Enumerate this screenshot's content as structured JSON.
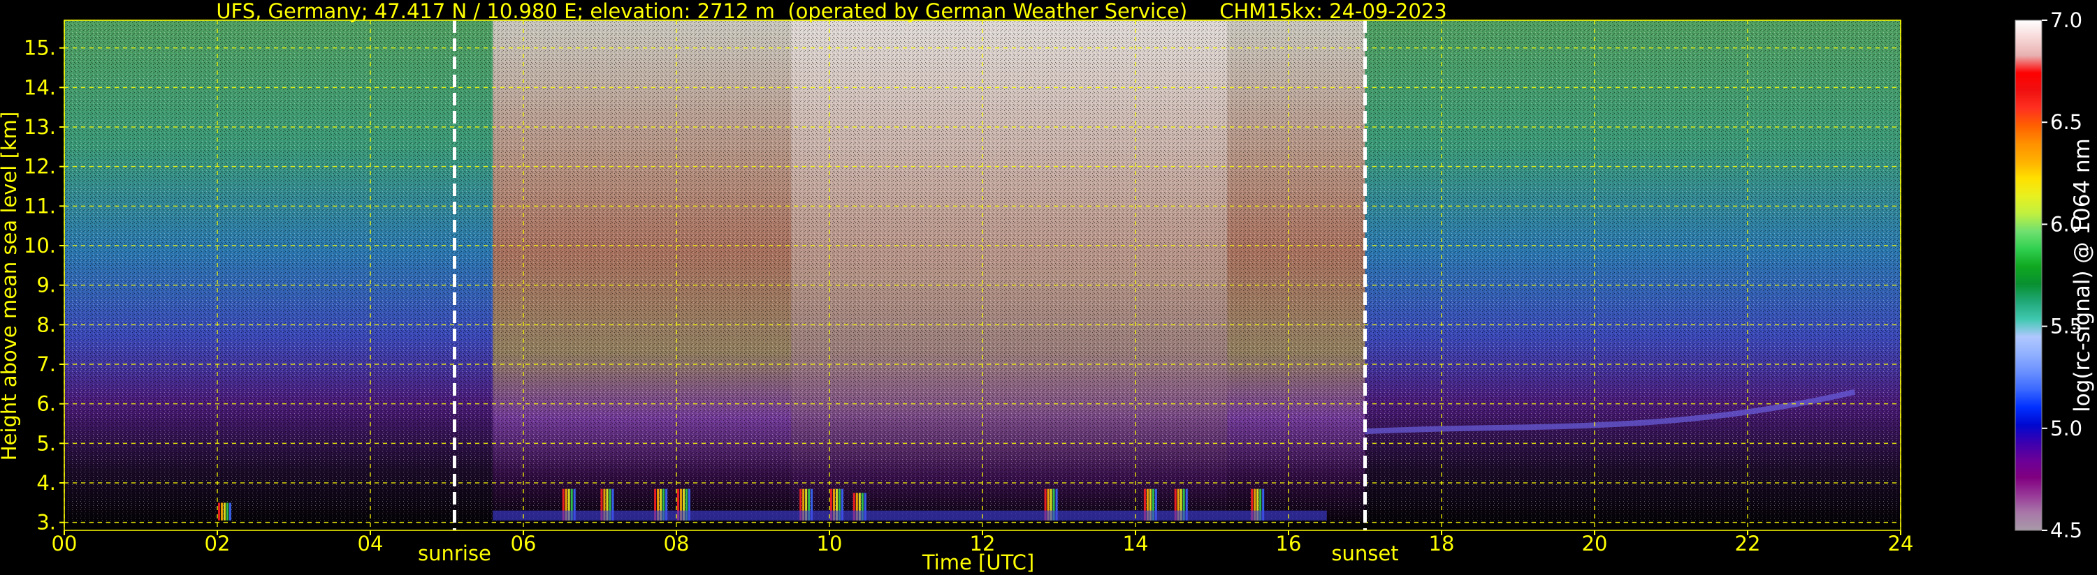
{
  "chart_data": {
    "type": "heatmap",
    "title": "UFS, Germany; 47.417 N / 10.980 E; elevation: 2712 m  (operated by German Weather Service)     CHM15kx: 24-09-2023",
    "xlabel": "Time [UTC]",
    "ylabel": "Height above mean sea level [km]",
    "xlim": [
      0,
      24
    ],
    "ylim": [
      2.8,
      15.7
    ],
    "x_ticks": [
      "00",
      "02",
      "04",
      "06",
      "08",
      "10",
      "12",
      "14",
      "16",
      "18",
      "20",
      "22",
      "24"
    ],
    "x_tick_values": [
      0,
      2,
      4,
      6,
      8,
      10,
      12,
      14,
      16,
      18,
      20,
      22,
      24
    ],
    "y_ticks": [
      "3.",
      "4.",
      "5.",
      "6.",
      "7.",
      "8.",
      "9.",
      "10.",
      "11.",
      "12.",
      "13.",
      "14.",
      "15."
    ],
    "y_tick_values": [
      3,
      4,
      5,
      6,
      7,
      8,
      9,
      10,
      11,
      12,
      13,
      14,
      15
    ],
    "grid": true,
    "annotations": [
      {
        "text": "sunrise",
        "x": 5.1
      },
      {
        "text": "sunset",
        "x": 17.0
      }
    ],
    "colorbar": {
      "label": "log(rc-signal) @ 1064 nm",
      "range": [
        4.5,
        7.0
      ],
      "ticks": [
        "4.5",
        "5.0",
        "5.5",
        "6.0",
        "6.5",
        "7.0"
      ],
      "tick_values": [
        4.5,
        5.0,
        5.5,
        6.0,
        6.5,
        7.0
      ],
      "colors": [
        "#a89aa8",
        "#a878a8",
        "#983898",
        "#800080",
        "#6a0098",
        "#3a00b0",
        "#0008d0",
        "#0030ff",
        "#3a68ff",
        "#6a90ff",
        "#90b0ff",
        "#b0c8ff",
        "#40c8b0",
        "#20a878",
        "#089030",
        "#10a820",
        "#30d050",
        "#70e070",
        "#c0f040",
        "#e8f020",
        "#ffe000",
        "#ffb000",
        "#ff9000",
        "#ff6000",
        "#ff3020",
        "#f01010",
        "#ff0000",
        "#e8b0b0",
        "#f8d8d8",
        "#ffffff"
      ]
    },
    "cloud_base_events": [
      {
        "x": 2.1,
        "height": 3.25
      },
      {
        "x": 6.6,
        "height": 3.6
      },
      {
        "x": 7.1,
        "height": 3.6
      },
      {
        "x": 7.8,
        "height": 3.6
      },
      {
        "x": 8.1,
        "height": 3.6
      },
      {
        "x": 9.7,
        "height": 3.6
      },
      {
        "x": 10.1,
        "height": 3.6
      },
      {
        "x": 10.4,
        "height": 3.5
      },
      {
        "x": 12.9,
        "height": 3.6
      },
      {
        "x": 14.2,
        "height": 3.6
      },
      {
        "x": 14.6,
        "height": 3.6
      },
      {
        "x": 15.6,
        "height": 3.6
      }
    ],
    "aerosol_layer": {
      "x_start": 17.0,
      "x_end": 23.4,
      "height_start": 5.3,
      "height_end": 6.3
    }
  }
}
